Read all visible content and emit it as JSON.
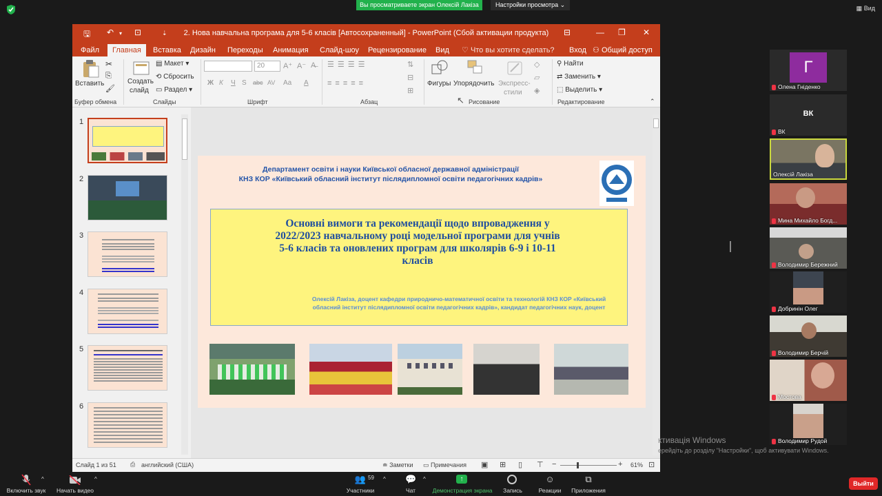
{
  "zoom": {
    "share_banner": "Вы просматриваете экран Олексій Лакіза",
    "view_settings": "Настройки просмотра",
    "view_label": "Вид"
  },
  "ppt": {
    "doc_title": "2. Нова навчальна програма для 5-6 класів [Автосохраненный] - PowerPoint (Сбой активации продукта)",
    "tabs": [
      "Файл",
      "Главная",
      "Вставка",
      "Дизайн",
      "Переходы",
      "Анимация",
      "Слайд-шоу",
      "Рецензирование",
      "Вид"
    ],
    "tell_me": "Что вы хотите сделать?",
    "login": "Вход",
    "share": "Общий доступ",
    "ribbon": {
      "paste": "Вставить",
      "clipboard": "Буфер обмена",
      "new_slide_1": "Создать",
      "new_slide_2": "слайд",
      "layout": "Макет",
      "reset": "Сбросить",
      "section": "Раздел",
      "slides": "Слайды",
      "font_size": "20",
      "font": "Шрифт",
      "paragraph": "Абзац",
      "shapes": "Фигуры",
      "arrange": "Упорядочить",
      "quick_styles_1": "Экспресс-",
      "quick_styles_2": "стили",
      "drawing": "Рисование",
      "find": "Найти",
      "replace": "Заменить",
      "select": "Выделить",
      "editing": "Редактирование",
      "font_buttons": [
        "Ж",
        "К",
        "Ч",
        "S",
        "abc",
        "AV",
        "Aa",
        "A"
      ]
    },
    "thumb_numbers": [
      "1",
      "2",
      "3",
      "4",
      "5",
      "6"
    ],
    "slide": {
      "dept_line1": "Департамент освіти і науки Київської обласної державної адміністрації",
      "dept_line2": "КНЗ КОР «Київський обласний інститут післядипломної освіти педагогічних кадрів»",
      "title_l1": "Основні вимоги та рекомендації щодо впровадження у",
      "title_l2": "2022/2023 навчальному році модельної програми для учнів",
      "title_l3": "5-6 класів та оновлених програм для школярів 6-9 і 10-11",
      "title_l4": "класів",
      "author_l1": "Олексій Лакіза, доцент кафедри природничо-математичної освіти та технологій КНЗ КОР «Київський",
      "author_l2": "обласний інститут післядипломної освіти педагогічних кадрів», кандидат педагогічних наук, доцент"
    },
    "status": {
      "slide_of": "Слайд 1 из 51",
      "language": "английский (США)",
      "notes": "Заметки",
      "comments": "Примечания",
      "zoom": "61%"
    }
  },
  "participants": [
    {
      "name": "Олена Гніденко",
      "initial": "Г",
      "bg": "#8e2c9e"
    },
    {
      "name": "ВК",
      "initial": "ВК",
      "bg": "#2a2a2a"
    },
    {
      "name": "Олексій Лакіза",
      "initial": "",
      "bg": "#6b6553"
    },
    {
      "name": "Мина Михайло Богд...",
      "initial": "",
      "bg": "#a04d46"
    },
    {
      "name": "Володимир Бережний",
      "initial": "",
      "bg": "#5a5a55"
    },
    {
      "name": "Добринін Олег",
      "initial": "",
      "bg": "#3d3f44"
    },
    {
      "name": "Володимир Берчій",
      "initial": "",
      "bg": "#4a4740"
    },
    {
      "name": "Мостова",
      "initial": "",
      "bg": "#b69988"
    },
    {
      "name": "Володимир Рудой",
      "initial": "",
      "bg": "#8f8d8a"
    }
  ],
  "windows_activation": {
    "title": "ктивація Windows",
    "subtitle": "ерейдіть до розділу \"Настройки\", щоб активувати Windows."
  },
  "bottombar": {
    "mute": "Включить звук",
    "video": "Начать видео",
    "participants": "Участники",
    "participants_count": "59",
    "chat": "Чат",
    "share": "Демонстрация экрана",
    "record": "Запись",
    "reactions": "Реакции",
    "apps": "Приложения",
    "leave": "Выйти"
  }
}
